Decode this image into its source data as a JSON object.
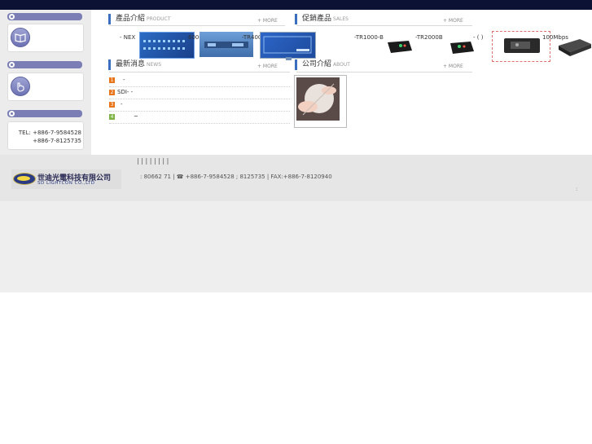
{
  "sidebar": {
    "tel_line1": "TEL: +886-7-9584528",
    "tel_line2": "+886-7-8125735"
  },
  "products": {
    "title": "產品介紹",
    "title_en": "PRODUCT",
    "more": "+ MORE",
    "items": [
      "- NEX",
      "6000-C",
      "-TR4000-"
    ]
  },
  "sales": {
    "title": "促銷產品",
    "title_en": "SALES",
    "more": "+ MORE",
    "items": [
      "-TR1000-B",
      "-TR2000B",
      "- ( )",
      "100Mbps"
    ]
  },
  "news": {
    "title": "最新消息",
    "title_en": "NEWS",
    "more": "+ MORE",
    "rows": [
      {
        "num": "1",
        "text": "-",
        "color": "#e8751a"
      },
      {
        "num": "2",
        "text": "SDI-  -",
        "color": "#e8751a"
      },
      {
        "num": "3",
        "text": "-",
        "color": "#e8751a"
      },
      {
        "num": "4",
        "text": "~",
        "color": "#7cb342"
      }
    ]
  },
  "about": {
    "title": "公司介紹",
    "title_en": "ABOUT",
    "more": "+ MORE"
  },
  "footer": {
    "nav_separators": "|   |   |   |   |   |   |   |",
    "company_cn": "世迪光電科技有限公司",
    "company_en": "SD LIGHTCON CO.,LTD",
    "address_line": ": 80662      71  | ☎ +886-7-9584528 ; 8125735 | FAX:+886-7-8120940",
    "right_mark": ":"
  },
  "colors": {
    "topbar": "#0c1233",
    "side_header": "#7a7eb4",
    "accent_blue": "#3a6fc0",
    "num_orange": "#e8751a"
  }
}
